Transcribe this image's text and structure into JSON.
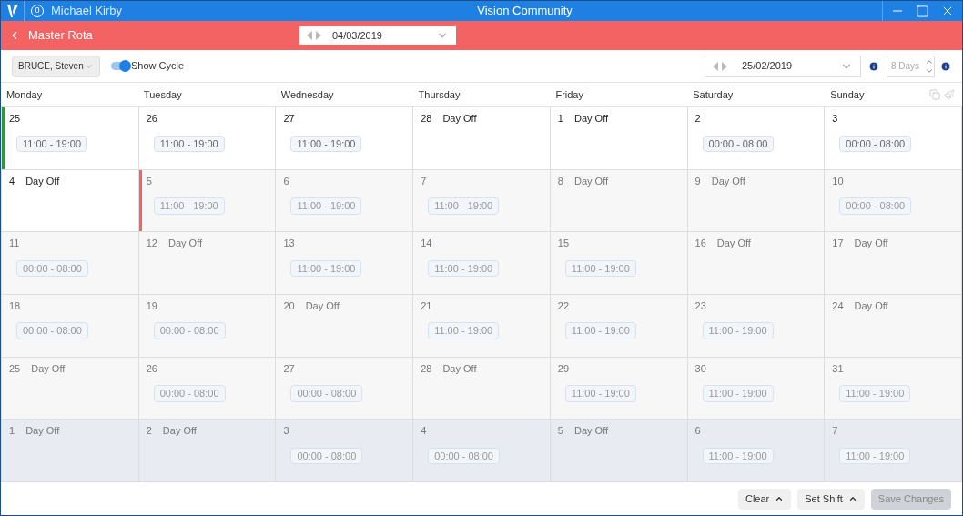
{
  "window": {
    "badge": "0",
    "user": "Michael Kirby",
    "title": "Vision Community"
  },
  "header": {
    "title": "Master Rota",
    "date": "04/03/2019"
  },
  "toolbar": {
    "staff": "BRUCE, Steven",
    "show_cycle": {
      "label": "Show Cycle",
      "on": true
    },
    "start_date": "25/02/2019",
    "days": "8 Days"
  },
  "weekdays": [
    "Monday",
    "Tuesday",
    "Wednesday",
    "Thursday",
    "Friday",
    "Saturday",
    "Sunday"
  ],
  "weeks": [
    [
      {
        "day": "25",
        "kind": "shift",
        "label": "11:00 - 19:00",
        "dimmed": false,
        "next_cycle": false,
        "color": "#2e9a2e"
      },
      {
        "day": "26",
        "kind": "shift",
        "label": "11:00 - 19:00",
        "dimmed": false,
        "next_cycle": false
      },
      {
        "day": "27",
        "kind": "shift",
        "label": "11:00 - 19:00",
        "dimmed": false,
        "next_cycle": false
      },
      {
        "day": "28",
        "kind": "off",
        "label": "Day Off",
        "dimmed": false,
        "next_cycle": false
      },
      {
        "day": "1",
        "kind": "off",
        "label": "Day Off",
        "dimmed": false,
        "next_cycle": false
      },
      {
        "day": "2",
        "kind": "shift",
        "label": "00:00 - 08:00",
        "dimmed": false,
        "next_cycle": false
      },
      {
        "day": "3",
        "kind": "shift",
        "label": "00:00 - 08:00",
        "dimmed": false,
        "next_cycle": false
      }
    ],
    [
      {
        "day": "4",
        "kind": "off",
        "label": "Day Off",
        "dimmed": false,
        "next_cycle": false
      },
      {
        "day": "5",
        "kind": "shift",
        "label": "11:00 - 19:00",
        "dimmed": true,
        "next_cycle": false,
        "color": "#f46363"
      },
      {
        "day": "6",
        "kind": "shift",
        "label": "11:00 - 19:00",
        "dimmed": true,
        "next_cycle": false
      },
      {
        "day": "7",
        "kind": "shift",
        "label": "11:00 - 19:00",
        "dimmed": true,
        "next_cycle": false
      },
      {
        "day": "8",
        "kind": "off",
        "label": "Day Off",
        "dimmed": true,
        "next_cycle": false
      },
      {
        "day": "9",
        "kind": "off",
        "label": "Day Off",
        "dimmed": true,
        "next_cycle": false
      },
      {
        "day": "10",
        "kind": "shift",
        "label": "00:00 - 08:00",
        "dimmed": true,
        "next_cycle": false
      }
    ],
    [
      {
        "day": "11",
        "kind": "shift",
        "label": "00:00 - 08:00",
        "dimmed": true,
        "next_cycle": false
      },
      {
        "day": "12",
        "kind": "off",
        "label": "Day Off",
        "dimmed": true,
        "next_cycle": false
      },
      {
        "day": "13",
        "kind": "shift",
        "label": "11:00 - 19:00",
        "dimmed": true,
        "next_cycle": false
      },
      {
        "day": "14",
        "kind": "shift",
        "label": "11:00 - 19:00",
        "dimmed": true,
        "next_cycle": false
      },
      {
        "day": "15",
        "kind": "shift",
        "label": "11:00 - 19:00",
        "dimmed": true,
        "next_cycle": false
      },
      {
        "day": "16",
        "kind": "off",
        "label": "Day Off",
        "dimmed": true,
        "next_cycle": false
      },
      {
        "day": "17",
        "kind": "off",
        "label": "Day Off",
        "dimmed": true,
        "next_cycle": false
      }
    ],
    [
      {
        "day": "18",
        "kind": "shift",
        "label": "00:00 - 08:00",
        "dimmed": true,
        "next_cycle": false
      },
      {
        "day": "19",
        "kind": "shift",
        "label": "00:00 - 08:00",
        "dimmed": true,
        "next_cycle": false
      },
      {
        "day": "20",
        "kind": "off",
        "label": "Day Off",
        "dimmed": true,
        "next_cycle": false
      },
      {
        "day": "21",
        "kind": "shift",
        "label": "11:00 - 19:00",
        "dimmed": true,
        "next_cycle": false
      },
      {
        "day": "22",
        "kind": "shift",
        "label": "11:00 - 19:00",
        "dimmed": true,
        "next_cycle": false
      },
      {
        "day": "23",
        "kind": "shift",
        "label": "11:00 - 19:00",
        "dimmed": true,
        "next_cycle": false
      },
      {
        "day": "24",
        "kind": "off",
        "label": "Day Off",
        "dimmed": true,
        "next_cycle": false
      }
    ],
    [
      {
        "day": "25",
        "kind": "off",
        "label": "Day Off",
        "dimmed": true,
        "next_cycle": false
      },
      {
        "day": "26",
        "kind": "shift",
        "label": "00:00 - 08:00",
        "dimmed": true,
        "next_cycle": false
      },
      {
        "day": "27",
        "kind": "shift",
        "label": "00:00 - 08:00",
        "dimmed": true,
        "next_cycle": false
      },
      {
        "day": "28",
        "kind": "off",
        "label": "Day Off",
        "dimmed": true,
        "next_cycle": false
      },
      {
        "day": "29",
        "kind": "shift",
        "label": "11:00 - 19:00",
        "dimmed": true,
        "next_cycle": false
      },
      {
        "day": "30",
        "kind": "shift",
        "label": "11:00 - 19:00",
        "dimmed": true,
        "next_cycle": false
      },
      {
        "day": "31",
        "kind": "shift",
        "label": "11:00 - 19:00",
        "dimmed": true,
        "next_cycle": false
      }
    ],
    [
      {
        "day": "1",
        "kind": "off",
        "label": "Day Off",
        "dimmed": true,
        "next_cycle": true
      },
      {
        "day": "2",
        "kind": "off",
        "label": "Day Off",
        "dimmed": true,
        "next_cycle": true
      },
      {
        "day": "3",
        "kind": "shift",
        "label": "00:00 - 08:00",
        "dimmed": true,
        "next_cycle": true
      },
      {
        "day": "4",
        "kind": "shift",
        "label": "00:00 - 08:00",
        "dimmed": true,
        "next_cycle": true
      },
      {
        "day": "5",
        "kind": "off",
        "label": "Day Off",
        "dimmed": true,
        "next_cycle": true
      },
      {
        "day": "6",
        "kind": "shift",
        "label": "11:00 - 19:00",
        "dimmed": true,
        "next_cycle": true
      },
      {
        "day": "7",
        "kind": "shift",
        "label": "11:00 - 19:00",
        "dimmed": true,
        "next_cycle": true
      }
    ]
  ],
  "footer": {
    "buttons": [
      {
        "label": "Clear",
        "menu": true,
        "disabled": false
      },
      {
        "label": "Set Shift",
        "menu": true,
        "disabled": false
      },
      {
        "label": "Save Changes",
        "menu": false,
        "disabled": true
      }
    ]
  }
}
